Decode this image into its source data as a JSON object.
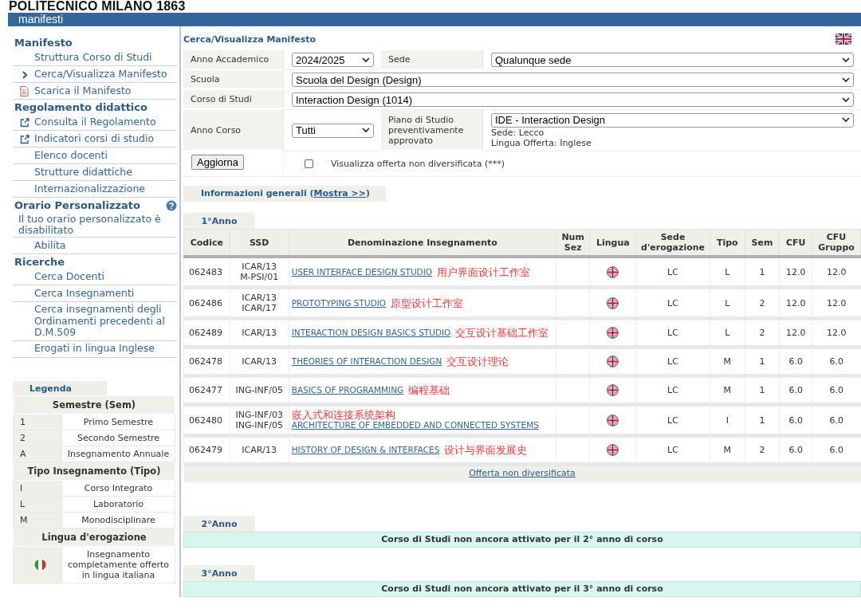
{
  "header": {
    "logo": "POLITECNICO MILANO 1863",
    "section": "manifesti"
  },
  "sidebar": {
    "groups": [
      {
        "title": "Manifesto",
        "items": [
          {
            "label": "Struttura Corso di Studi",
            "kind": "plain"
          },
          {
            "label": "Cerca/Visualizza Manifesto",
            "kind": "current"
          },
          {
            "label": "Scarica il Manifesto",
            "kind": "download"
          }
        ]
      },
      {
        "title": "Regolamento didattico",
        "items": [
          {
            "label": "Consulta il Regolamento",
            "kind": "external"
          },
          {
            "label": "Indicatori corsi di studio",
            "kind": "external"
          },
          {
            "label": "Elenco docenti",
            "kind": "plain"
          },
          {
            "label": "Strutture didattiche",
            "kind": "plain"
          },
          {
            "label": "Internazionalizzazione",
            "kind": "plain"
          }
        ]
      },
      {
        "title": "Orario Personalizzato",
        "help": true,
        "note": "Il tuo orario personalizzato è disabilitato",
        "items": [
          {
            "label": "Abilita",
            "kind": "plain"
          }
        ]
      },
      {
        "title": "Ricerche",
        "items": [
          {
            "label": "Cerca Docenti",
            "kind": "plain"
          },
          {
            "label": "Cerca Insegnamenti",
            "kind": "plain"
          },
          {
            "label": "Cerca insegnamenti degli Ordinamenti precedenti al D.M.509",
            "kind": "plain"
          },
          {
            "label": "Erogati in lingua Inglese",
            "kind": "plain"
          }
        ]
      }
    ],
    "legend": {
      "title": "Legenda",
      "sections": [
        {
          "heading": "Semestre (Sem)",
          "rows": [
            {
              "key": "1",
              "text": "Primo Semestre"
            },
            {
              "key": "2",
              "text": "Secondo Semestre"
            },
            {
              "key": "A",
              "text": "Insegnamento Annuale"
            }
          ]
        },
        {
          "heading": "Tipo Insegnamento (Tipo)",
          "rows": [
            {
              "key": "I",
              "text": "Corso Integrato"
            },
            {
              "key": "L",
              "text": "Laboratorio"
            },
            {
              "key": "M",
              "text": "Monodisciplinare"
            }
          ]
        },
        {
          "heading": "Lingua d'erogazione",
          "rows": [
            {
              "kind": "flag",
              "text": "Insegnamento completamente offerto in lingua italiana"
            }
          ]
        }
      ]
    }
  },
  "main": {
    "title": "Cerca/Visualizza Manifesto",
    "form": {
      "anno_accademico": {
        "label": "Anno Accademico",
        "value": "2024/2025"
      },
      "sede": {
        "label": "Sede",
        "value": "Qualunque sede"
      },
      "scuola": {
        "label": "Scuola",
        "value": "Scuola del Design (Design)"
      },
      "corso": {
        "label": "Corso di Studi",
        "value": "Interaction Design (1014)"
      },
      "anno_corso": {
        "label": "Anno Corso",
        "value": "Tutti"
      },
      "piano": {
        "label": "Piano di Studio preventivamente approvato",
        "value": "IDE - Interaction Design",
        "notes": [
          "Sede: Lecco",
          "Lingua Offerta: Inglese"
        ]
      },
      "button": "Aggiorna",
      "checkbox": {
        "label": "Visualizza offerta non diversificata (***)",
        "checked": false
      }
    },
    "info": {
      "prefix": "Informazioni generali (",
      "link": "Mostra >>",
      "suffix": ")"
    },
    "years": [
      {
        "tab": "1°Anno",
        "table": {
          "columns": [
            "Codice",
            "SSD",
            "Denominazione Insegnamento",
            "Num Sez",
            "Lingua",
            "Sede d'erogazione",
            "Tipo",
            "Sem",
            "CFU",
            "CFU Gruppo"
          ],
          "rows": [
            {
              "codice": "062483",
              "ssd": [
                "ICAR/13",
                "M-PSI/01"
              ],
              "name": "USER INTERFACE DESIGN STUDIO",
              "note": "用户界面设计工作室",
              "sede": "LC",
              "tipo": "L",
              "sem": "1",
              "cfu": "12.0",
              "cfu_gruppo": "12.0"
            },
            {
              "codice": "062486",
              "ssd": [
                "ICAR/13",
                "ICAR/17"
              ],
              "name": "PROTOTYPING STUDIO",
              "note": "原型设计工作室",
              "sede": "LC",
              "tipo": "L",
              "sem": "2",
              "cfu": "12.0",
              "cfu_gruppo": "12.0"
            },
            {
              "codice": "062489",
              "ssd": [
                "ICAR/13"
              ],
              "name": "INTERACTION DESIGN BASICS STUDIO",
              "note": "交互设计基础工作室",
              "sede": "LC",
              "tipo": "L",
              "sem": "2",
              "cfu": "12.0",
              "cfu_gruppo": "12.0"
            },
            {
              "codice": "062478",
              "ssd": [
                "ICAR/13"
              ],
              "name": "THEORIES OF INTERACTION DESIGN",
              "note": "交互设计理论",
              "sede": "LC",
              "tipo": "M",
              "sem": "1",
              "cfu": "6.0",
              "cfu_gruppo": "6.0"
            },
            {
              "codice": "062477",
              "ssd": [
                "ING-INF/05"
              ],
              "name": "BASICS OF PROGRAMMING",
              "note": "编程基础",
              "sede": "LC",
              "tipo": "M",
              "sem": "1",
              "cfu": "6.0",
              "cfu_gruppo": "6.0"
            },
            {
              "codice": "062480",
              "ssd": [
                "ING-INF/03",
                "ING-INF/05"
              ],
              "name": "ARCHITECTURE OF EMBEDDED AND CONNECTED SYSTEMS",
              "note": "嵌入式和连接系统架构",
              "sede": "LC",
              "tipo": "I",
              "sem": "1",
              "cfu": "6.0",
              "cfu_gruppo": "6.0"
            },
            {
              "codice": "062479",
              "ssd": [
                "ICAR/13"
              ],
              "name": "HISTORY OF DESIGN & INTERFACES",
              "note": "设计与界面发展史",
              "sede": "LC",
              "tipo": "M",
              "sem": "2",
              "cfu": "6.0",
              "cfu_gruppo": "6.0"
            }
          ]
        },
        "footer_link": "Offerta non diversificata"
      },
      {
        "tab": "2°Anno",
        "message": "Corso di Studi non ancora attivato per il 2° anno di corso"
      },
      {
        "tab": "3°Anno",
        "message": "Corso di Studi non ancora attivato per il 3° anno di corso"
      }
    ]
  }
}
